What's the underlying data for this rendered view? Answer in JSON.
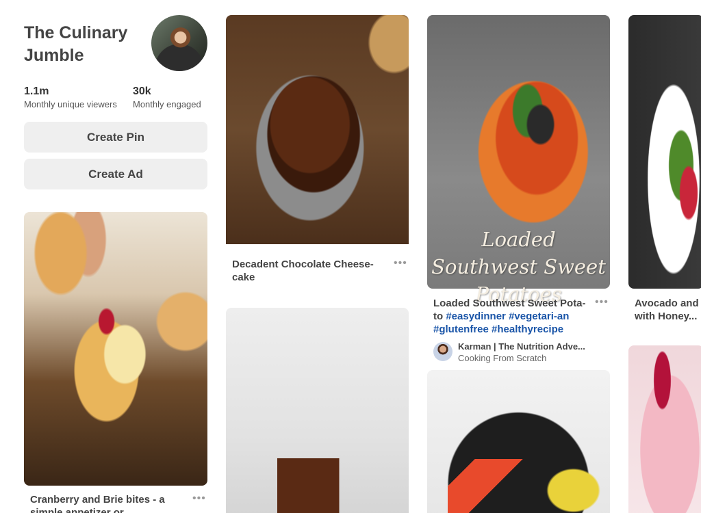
{
  "profile": {
    "name": "The Culinary Jumble",
    "stats": [
      {
        "value": "1.1m",
        "label": "Monthly unique viewers"
      },
      {
        "value": "30k",
        "label": "Monthly engaged"
      }
    ],
    "create_pin_label": "Create Pin",
    "create_ad_label": "Create Ad"
  },
  "pins": {
    "cranberry": {
      "title": "Cranberry and Brie bites - a simple appetizer or"
    },
    "chocolate": {
      "title": "Decadent Chocolate Cheese-cake"
    },
    "potato": {
      "overlay_text": "Loaded Southwest Sweet Potatoes",
      "title_prefix": "Loaded Southwest Sweet Pota-to",
      "hashtags": [
        "#easydinner",
        "#vegetari-an",
        "#glutenfree",
        "#healthyrecipe"
      ],
      "pinner_name": "Karman | The Nutrition Adve...",
      "board": "Cooking From Scratch"
    },
    "avocado": {
      "title": "Avocado and S with Honey..."
    }
  },
  "icons": {
    "more": "more-dots-icon"
  },
  "colors": {
    "hashtag": "#1a55a8",
    "button_bg": "#efefef"
  }
}
